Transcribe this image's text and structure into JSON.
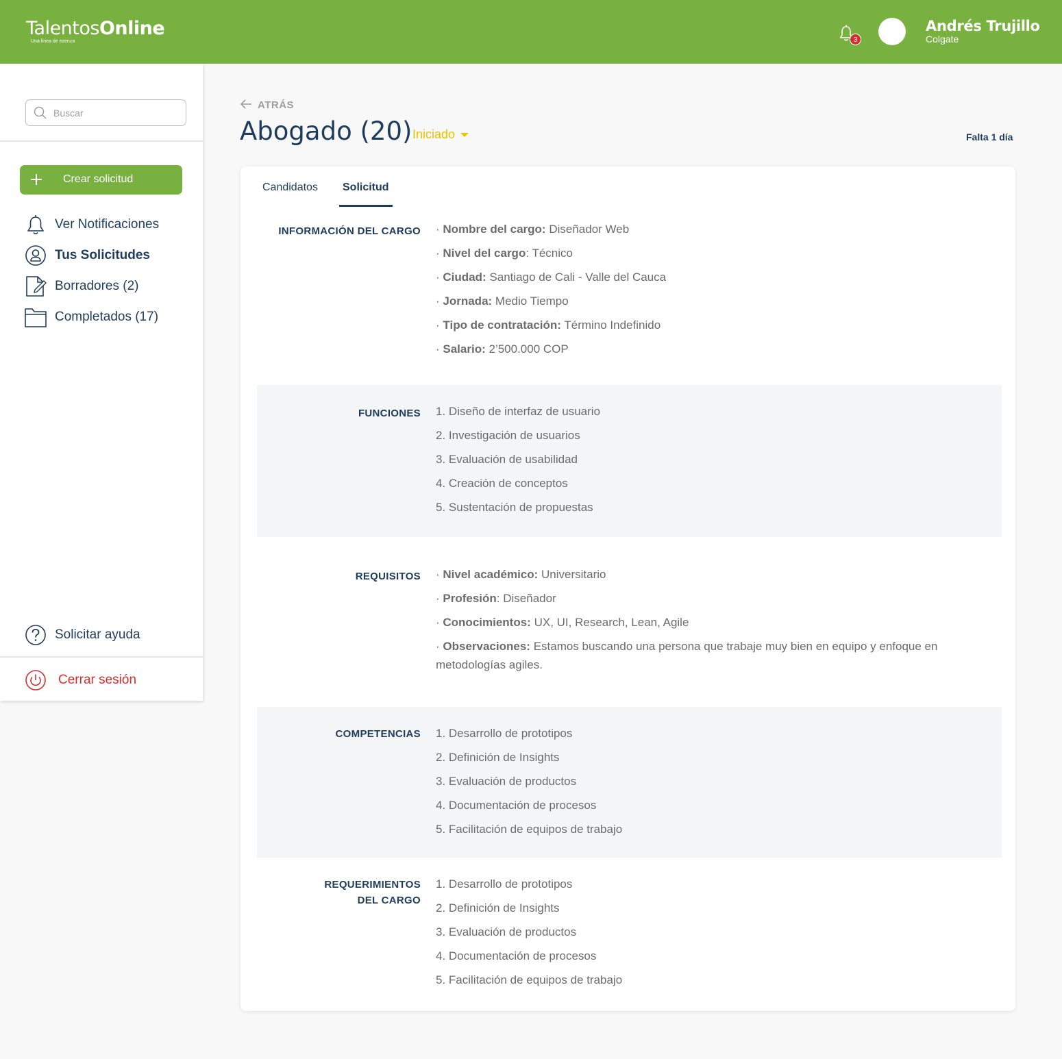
{
  "header": {
    "logo_text_regular": "Talentos",
    "logo_text_bold": "Online",
    "logo_tagline": "Una línea de ezenza",
    "notifications_count": "3",
    "user_name": "Andrés Trujillo",
    "user_company": "Colgate",
    "colors": {
      "bar": "#78b13f",
      "badge": "#d32f2f"
    }
  },
  "sidebar": {
    "search_placeholder": "Buscar",
    "create_label": "Crear solicitud",
    "items": [
      {
        "label": "Ver Notificaciones",
        "icon": "bell-icon"
      },
      {
        "label": "Tus Solicitudes",
        "icon": "user-circle-icon",
        "active": true
      },
      {
        "label": "Borradores (2)",
        "icon": "document-edit-icon"
      },
      {
        "label": "Completados (17)",
        "icon": "folder-icon"
      }
    ],
    "help_label": "Solicitar ayuda",
    "logout_label": "Cerrar sesión"
  },
  "main": {
    "back_label": "ATRÁS",
    "title": "Abogado (20)",
    "status": "Iniciado",
    "deadline": "Falta 1 día",
    "status_color": "#e6c300",
    "tabs": [
      "Candidatos",
      "Solicitud"
    ],
    "active_tab": "Solicitud",
    "sections": {
      "info": {
        "label": "INFORMACIÓN DEL CARGO",
        "items": [
          {
            "key": "Nombre del cargo:",
            "value": "Diseñador Web"
          },
          {
            "key": "Nivel del cargo",
            "value": ": Técnico"
          },
          {
            "key": "Ciudad:",
            "value": "Santiago de Cali - Valle del Cauca"
          },
          {
            "key": "Jornada:",
            "value": "Medio Tiempo"
          },
          {
            "key": "Tipo de contratación:",
            "value": "Término Indefinido"
          },
          {
            "key": "Salario:",
            "value": "2’500.000 COP"
          }
        ]
      },
      "funciones": {
        "label": "FUNCIONES",
        "items": [
          "1. Diseño de interfaz de usuario",
          "2. Investigación de usuarios",
          "3. Evaluación de usabilidad",
          "4. Creación de conceptos",
          "5. Sustentación de propuestas"
        ]
      },
      "requisitos": {
        "label": "REQUISITOS",
        "items": [
          {
            "key": "Nivel académico:",
            "value": "Universitario"
          },
          {
            "key": "Profesión",
            "value": ": Diseñador"
          },
          {
            "key": "Conocimientos:",
            "value": "UX, UI, Research, Lean, Agile"
          },
          {
            "key": "Observaciones:",
            "value": "Estamos buscando una persona que trabaje muy bien en equipo y enfoque en metodologías agiles."
          }
        ]
      },
      "competencias": {
        "label": "COMPETENCIAS",
        "items": [
          "1. Desarrollo de prototipos",
          "2. Definición de Insights",
          "3. Evaluación de productos",
          "4. Documentación de procesos",
          "5. Facilitación de equipos de trabajo"
        ]
      },
      "requerimientos": {
        "label_line1": "REQUERIMIENTOS",
        "label_line2": "DEL CARGO",
        "items": [
          "1. Desarrollo de prototipos",
          "2. Definición de Insights",
          "3. Evaluación de productos",
          "4. Documentación de procesos",
          "5. Facilitación de equipos de trabajo"
        ]
      }
    }
  }
}
